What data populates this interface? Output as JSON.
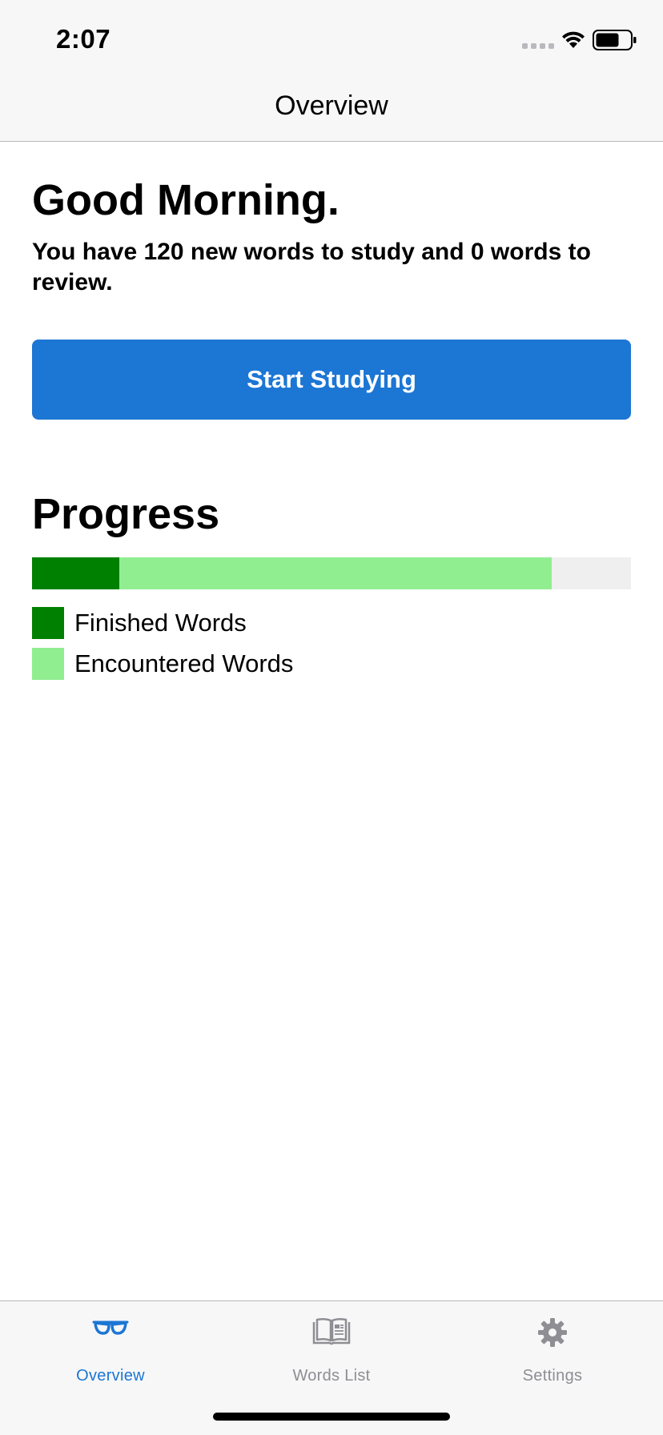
{
  "status_bar": {
    "time": "2:07"
  },
  "nav": {
    "title": "Overview"
  },
  "main": {
    "greeting": "Good Morning.",
    "summary": "You have 120 new words to study and 0 words to review.",
    "start_button_label": "Start Studying",
    "progress_title": "Progress",
    "progress": {
      "finished_fraction": 0.146,
      "encountered_fraction": 0.868,
      "finished_color": "#008000",
      "encountered_color": "#90ee90",
      "track_color": "#efefef"
    },
    "legend": {
      "finished_label": "Finished Words",
      "encountered_label": "Encountered Words"
    }
  },
  "colors": {
    "accent": "#1c76d4",
    "inactive_tab": "#8e8e93"
  },
  "tab_bar": {
    "tabs": [
      {
        "label": "Overview",
        "icon": "glasses-icon",
        "active": true
      },
      {
        "label": "Words List",
        "icon": "book-icon",
        "active": false
      },
      {
        "label": "Settings",
        "icon": "gear-icon",
        "active": false
      }
    ]
  }
}
